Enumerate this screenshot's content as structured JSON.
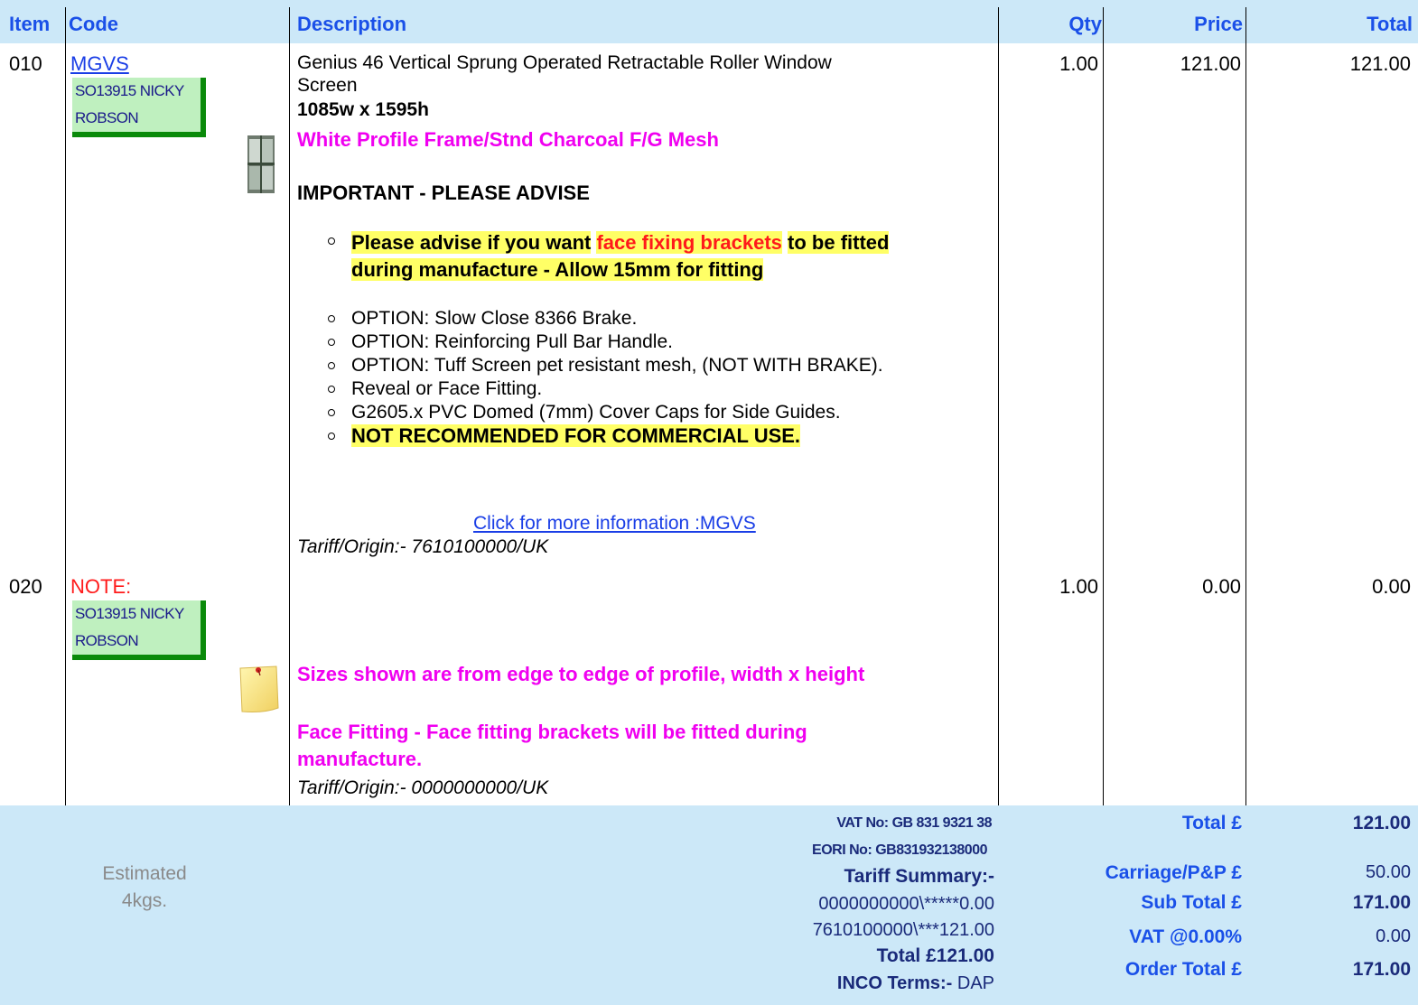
{
  "header": {
    "item": "Item",
    "code": "Code",
    "description": "Description",
    "qty": "Qty",
    "price": "Price",
    "total": "Total"
  },
  "lines": [
    {
      "item": "010",
      "code": "MGVS",
      "ref_line1": "SO13915 NICKY",
      "ref_line2": "ROBSON",
      "thumb_icon": "window-photo-icon",
      "title_line1": "Genius 46 Vertical Sprung Operated Retractable Roller Window",
      "title_line2": "Screen",
      "size": "1085w x 1595h",
      "profile": "White Profile Frame/Stnd Charcoal F/G Mesh",
      "important": "IMPORTANT - PLEASE ADVISE",
      "advise_pre": "Please advise if you want",
      "advise_highlight": "face fixing brackets",
      "advise_post": "to be fitted",
      "advise_line2": "during manufacture - Allow 15mm for fitting",
      "options": [
        "OPTION: Slow Close 8366 Brake.",
        "OPTION: Reinforcing Pull Bar Handle.",
        "OPTION: Tuff Screen pet resistant mesh, (NOT WITH BRAKE).",
        "Reveal or Face Fitting.",
        "G2605.x PVC Domed (7mm) Cover Caps for Side Guides."
      ],
      "warning": "NOT RECOMMENDED FOR COMMERCIAL USE.",
      "more_info_link": "Click for more information :MGVS",
      "tariff": "Tariff/Origin:- 7610100000/UK",
      "qty": "1.00",
      "price": "121.00",
      "total": "121.00"
    },
    {
      "item": "020",
      "code": "NOTE:",
      "ref_line1": "SO13915 NICKY",
      "ref_line2": "ROBSON",
      "thumb_icon": "sticky-note-icon",
      "note1": "Sizes shown are from edge to edge of profile, width x height",
      "note2_line1": "Face Fitting - Face fitting brackets will be fitted during",
      "note2_line2": "manufacture.",
      "tariff": "Tariff/Origin:- 0000000000/UK",
      "qty": "1.00",
      "price": "0.00",
      "total": "0.00"
    }
  ],
  "footer": {
    "weight_line1": "Estimated",
    "weight_line2": "4kgs.",
    "vat_no": "VAT No: GB 831 9321 38",
    "eori_no": "EORI No: GB831932138000",
    "tariff_summary_label": "Tariff Summary:-",
    "tariff_summary_1": "0000000000\\*****0.00",
    "tariff_summary_2": "7610100000\\***121.00",
    "tariff_total": "Total £121.00",
    "inco_label": "INCO Terms:-",
    "inco_value": "DAP",
    "totals": [
      {
        "label": "Total £",
        "value": "121.00",
        "bold": true
      },
      {
        "label": "Carriage/P&P £",
        "value": "50.00",
        "bold": false
      },
      {
        "label": "Sub Total £",
        "value": "171.00",
        "bold": true
      },
      {
        "label": "VAT @0.00%",
        "value": "0.00",
        "bold": false
      },
      {
        "label": "Order Total £",
        "value": "171.00",
        "bold": true
      }
    ]
  },
  "colors": {
    "header_bg": "#cce8f8",
    "header_text": "#1a50e8",
    "magenta": "#f000f0",
    "highlight": "#ffff66",
    "ref_bg": "#bff0bf",
    "ref_border": "#0a8a0a",
    "note_red": "#ff1a1a"
  }
}
